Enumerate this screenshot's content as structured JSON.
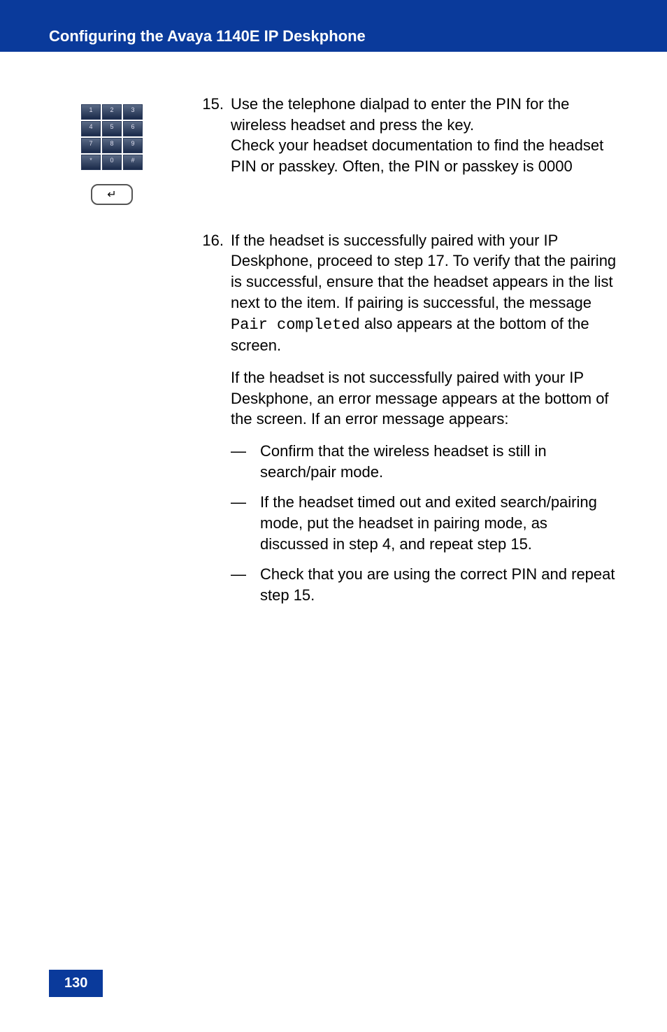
{
  "header": {
    "title": "Configuring the Avaya 1140E IP Deskphone"
  },
  "dialpad": {
    "keys": [
      "1",
      "2",
      "3",
      "4",
      "5",
      "6",
      "7",
      "8",
      "9",
      "*",
      "0",
      "#"
    ],
    "enterGlyph": "↵"
  },
  "steps": [
    {
      "num": "15.",
      "para1_a": "Use the telephone dialpad to enter the PIN for the wireless headset and press the ",
      "para1_b": " key.",
      "para2": "Check your headset documentation to find the headset PIN or passkey. Often, the PIN or passkey is 0000"
    },
    {
      "num": "16.",
      "para1_a": "If the headset is successfully paired with your IP Deskphone, proceed to step 17. To verify that the pairing is successful, ensure that the headset appears in the list next to the ",
      "para1_b": " item. If pairing is successful, the message ",
      "para1_mono": "Pair completed",
      "para1_c": " also appears at the bottom of the screen.",
      "para2": "If the headset is not successfully paired with your IP Deskphone, an error message appears at the bottom of the screen. If an error message appears:",
      "bullets": [
        "Confirm that the wireless headset is still in search/pair mode.",
        "If the headset timed out and exited search/pairing mode, put the headset in pairing mode, as discussed in step 4, and repeat step 15.",
        "Check that you are using the correct PIN and repeat step 15."
      ]
    }
  ],
  "pageNumber": "130"
}
